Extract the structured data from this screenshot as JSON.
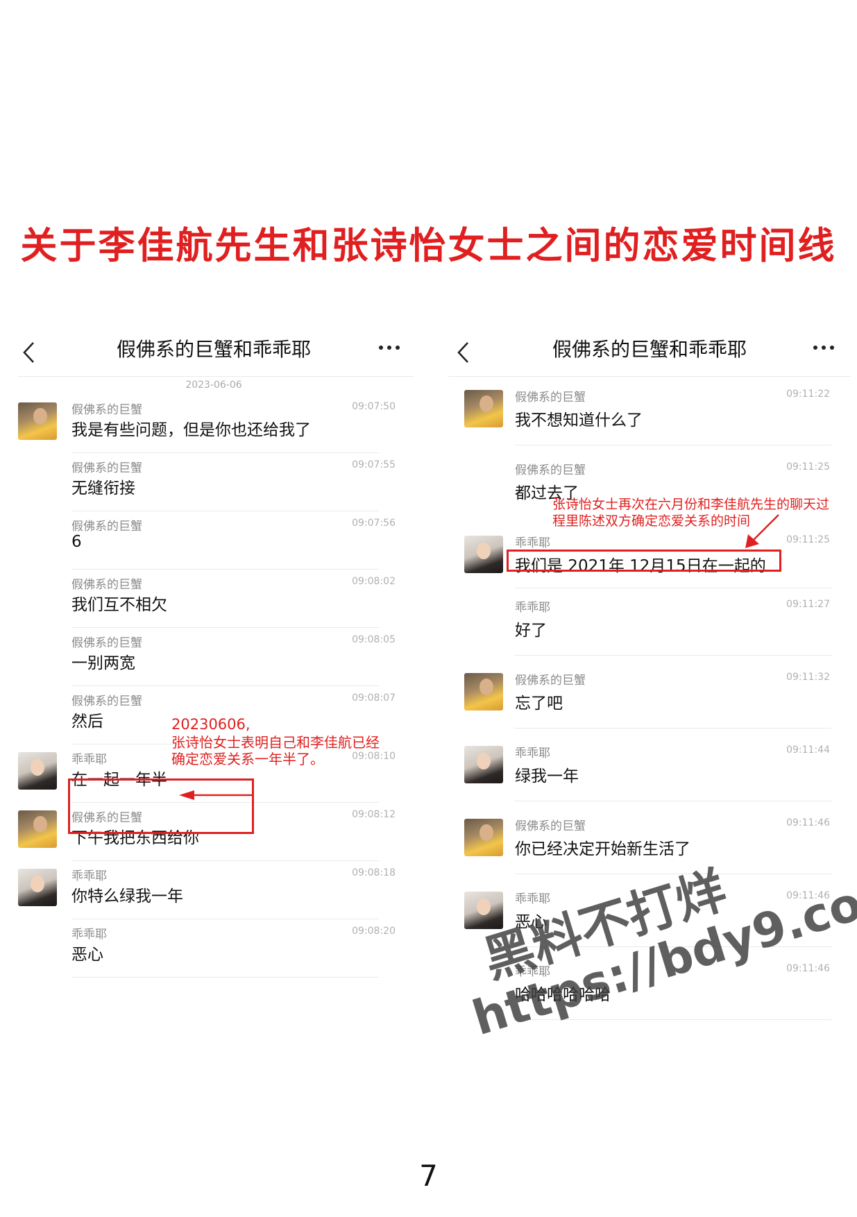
{
  "page": {
    "title": "关于李佳航先生和张诗怡女士之间的恋爱时间线",
    "page_number": "7",
    "watermark_line1": "黑料不打烊",
    "watermark_line2": "https://bdy9.co"
  },
  "left_panel": {
    "header_title": "假佛系的巨蟹和乖乖耶",
    "date": "2023-06-06",
    "messages": [
      {
        "sender": "假佛系的巨蟹",
        "time": "09:07:50",
        "text": "我是有些问题，但是你也还给我了",
        "avatar": "crab"
      },
      {
        "sender": "假佛系的巨蟹",
        "time": "09:07:55",
        "text": "无缝衔接"
      },
      {
        "sender": "假佛系的巨蟹",
        "time": "09:07:56",
        "text": "6"
      },
      {
        "sender": "假佛系的巨蟹",
        "time": "09:08:02",
        "text": "我们互不相欠"
      },
      {
        "sender": "假佛系的巨蟹",
        "time": "09:08:05",
        "text": "一别两宽"
      },
      {
        "sender": "假佛系的巨蟹",
        "time": "09:08:07",
        "text": "然后"
      },
      {
        "sender": "乖乖耶",
        "time": "09:08:10",
        "text": "在一起一年半",
        "avatar": "girl"
      },
      {
        "sender": "假佛系的巨蟹",
        "time": "09:08:12",
        "text": "下午我把东西给你",
        "avatar": "crab"
      },
      {
        "sender": "乖乖耶",
        "time": "09:08:18",
        "text": "你特么绿我一年",
        "avatar": "girl"
      },
      {
        "sender": "乖乖耶",
        "time": "09:08:20",
        "text": "恶心"
      }
    ],
    "annotation": {
      "line1": "20230606,",
      "line2": "张诗怡女士表明自己和李佳航已经",
      "line3": "确定恋爱关系一年半了。"
    }
  },
  "right_panel": {
    "header_title": "假佛系的巨蟹和乖乖耶",
    "messages": [
      {
        "sender": "假佛系的巨蟹",
        "time": "09:11:22",
        "text": "我不想知道什么了",
        "avatar": "crab"
      },
      {
        "sender": "假佛系的巨蟹",
        "time": "09:11:25",
        "text": "都过去了"
      },
      {
        "sender": "乖乖耶",
        "time": "09:11:25",
        "text": "我们是 2021年 12月15日在一起的",
        "avatar": "girl"
      },
      {
        "sender": "乖乖耶",
        "time": "09:11:27",
        "text": "好了"
      },
      {
        "sender": "假佛系的巨蟹",
        "time": "09:11:32",
        "text": "忘了吧",
        "avatar": "crab"
      },
      {
        "sender": "乖乖耶",
        "time": "09:11:44",
        "text": "绿我一年",
        "avatar": "girl"
      },
      {
        "sender": "假佛系的巨蟹",
        "time": "09:11:46",
        "text": "你已经决定开始新生活了",
        "avatar": "crab"
      },
      {
        "sender": "乖乖耶",
        "time": "09:11:46",
        "text": "恶心",
        "avatar": "girl"
      },
      {
        "sender": "乖乖耶",
        "time": "09:11:46",
        "text": "哈哈哈哈哈哈"
      }
    ],
    "annotation": {
      "line1": "张诗怡女士再次在六月份和李佳航先生的聊天过",
      "line2": "程里陈述双方确定恋爱关系的时间"
    }
  },
  "colors": {
    "annotation_red": "#e02020",
    "title_red": "#e02020"
  }
}
